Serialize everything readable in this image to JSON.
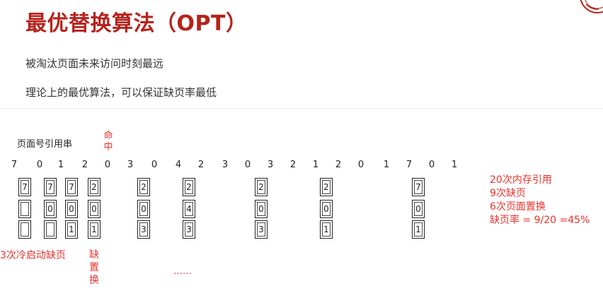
{
  "title": "最优替换算法（OPT）",
  "bullets": [
    "被淘汰页面未来访问时刻最远",
    "理论上的最优算法，可以保证缺页率最低"
  ],
  "ref_string_label": "页面号引用串",
  "hit_label": "命中",
  "cold_start_label": "3次冷启动缺页",
  "replace_label": "缺置换",
  "ellipsis": "……",
  "reference_string": [
    "7",
    "0",
    "1",
    "2",
    "0",
    "3",
    "0",
    "4",
    "2",
    "3",
    "0",
    "3",
    "2",
    "1",
    "2",
    "0",
    "1",
    "7",
    "0",
    "1"
  ],
  "frames": [
    [
      "7",
      "",
      ""
    ],
    [
      "7",
      "0",
      ""
    ],
    [
      "7",
      "0",
      "1"
    ],
    [
      "2",
      "0",
      "1"
    ],
    [
      "2",
      "0",
      "3"
    ],
    [
      "2",
      "4",
      "3"
    ],
    [
      "2",
      "0",
      "3"
    ],
    [
      "2",
      "0",
      "1"
    ],
    [
      "7",
      "0",
      "1"
    ]
  ],
  "stats": [
    "20次内存引用",
    "9次缺页",
    "6次页面置换",
    "缺页率 = 9/20 =45%"
  ],
  "colors": {
    "title": "#b5231c",
    "accent": "#e8322c",
    "text": "#333333"
  }
}
